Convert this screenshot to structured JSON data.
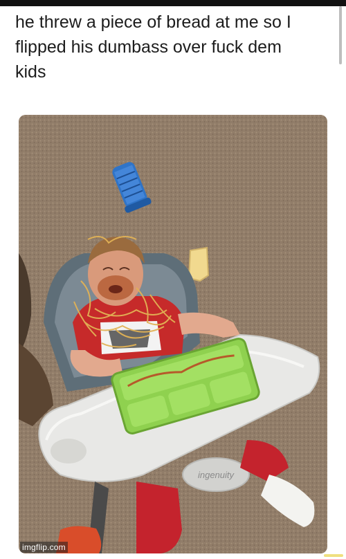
{
  "post": {
    "caption": "he threw a piece of bread at me so I\nflipped his dumbass over fuck dem\nkids"
  },
  "photo": {
    "tray_brand": "ingenuity"
  },
  "watermark": {
    "text": "imgflip.com"
  },
  "colors": {
    "carpet": "#9b8570",
    "tray": "#8fd14f",
    "chair": "#e8e8e6",
    "shirt": "#c62a2a",
    "sippy_cup": "#2f74c8"
  }
}
